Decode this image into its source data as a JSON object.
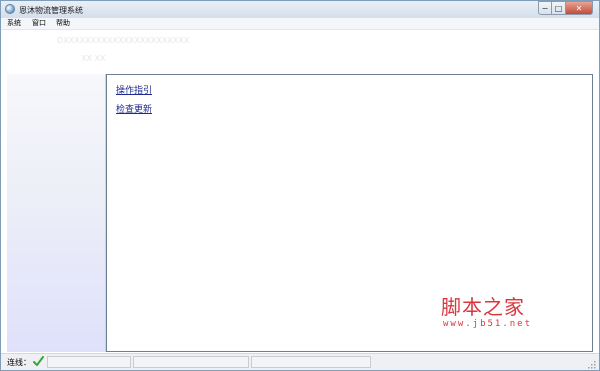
{
  "window": {
    "title": "恩沐物流管理系统",
    "controls": {
      "minimize": "−",
      "maximize": "□",
      "close": "✕"
    }
  },
  "menu": {
    "items": [
      {
        "label": "系统"
      },
      {
        "label": "窗口"
      },
      {
        "label": "帮助"
      }
    ]
  },
  "toolbar": {
    "faint_line1": "DXXXXXXXXXXXXXXXXXXXXXXX",
    "faint_line2": "XX XX"
  },
  "content": {
    "links": [
      {
        "label": "操作指引"
      },
      {
        "label": "检查更新"
      }
    ]
  },
  "status": {
    "connection_label": "连线：",
    "connection_icon": "check-icon",
    "connection_color": "#3aa53a"
  },
  "watermark": {
    "main": "脚本之家",
    "sub": "www.jb51.net",
    "color": "#d9363e"
  }
}
